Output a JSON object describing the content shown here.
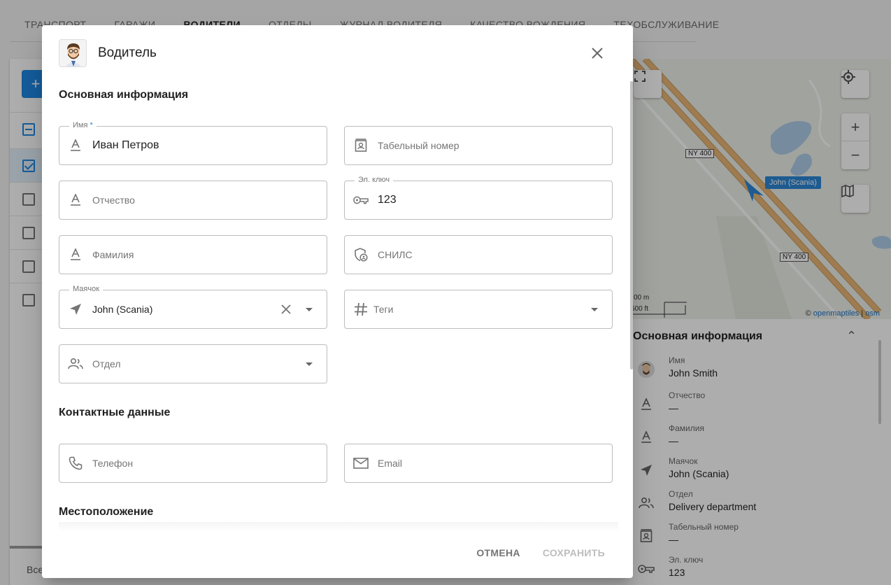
{
  "background": {
    "tabs": [
      "Транспорт",
      "Гаражи",
      "Водители",
      "Отделы",
      "Журнал водителя",
      "Качество вождения",
      "Техобслуживание"
    ],
    "active_tab": "Водители",
    "footer_text": "Все",
    "map": {
      "road_labels": [
        "NY 400",
        "NY 400"
      ],
      "vehicle_label": "John (Scania)",
      "scale_m": "00 m",
      "scale_ft": "500 ft",
      "attribution_prefix": "©",
      "attribution_link1": "openmaptiles",
      "attribution_sep": "|",
      "attribution_link2": "osm"
    },
    "info_panel": {
      "title": "Основная информация",
      "rows": [
        {
          "label": "Имя",
          "value": "John Smith",
          "icon": "avatar"
        },
        {
          "label": "Отчество",
          "value": "—",
          "icon": "text-format-icon"
        },
        {
          "label": "Фамилия",
          "value": "—",
          "icon": "text-format-icon"
        },
        {
          "label": "Маячок",
          "value": "John (Scania)",
          "icon": "navigation-icon"
        },
        {
          "label": "Отдел",
          "value": "Delivery department",
          "icon": "people-icon"
        },
        {
          "label": "Табельный номер",
          "value": "—",
          "icon": "badge-icon"
        },
        {
          "label": "Эл. ключ",
          "value": "123",
          "icon": "key-icon"
        }
      ]
    }
  },
  "dialog": {
    "title": "Водитель",
    "sections": {
      "basic": "Основная информация",
      "contacts": "Контактные данные",
      "location": "Местоположение"
    },
    "fields": {
      "first_name": {
        "label": "Имя",
        "required_mark": "*",
        "value": "Иван Петров"
      },
      "personnel_number": {
        "placeholder": "Табельный номер"
      },
      "patronymic": {
        "placeholder": "Отчество"
      },
      "key": {
        "label": "Эл. ключ",
        "value": "123"
      },
      "last_name": {
        "placeholder": "Фамилия"
      },
      "snils": {
        "placeholder": "СНИЛС"
      },
      "tracker": {
        "label": "Маячок",
        "value": "John (Scania)"
      },
      "tags": {
        "placeholder": "Теги"
      },
      "department": {
        "placeholder": "Отдел"
      },
      "phone": {
        "placeholder": "Телефон"
      },
      "email": {
        "placeholder": "Email"
      }
    },
    "buttons": {
      "cancel": "Отмена",
      "save": "Сохранить"
    }
  },
  "colors": {
    "accent": "#1e88e5",
    "vehicle_marker": "#2c87d6",
    "road": "#e9b676"
  }
}
